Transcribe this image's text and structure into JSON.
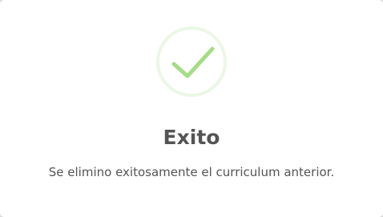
{
  "dialog": {
    "icon": "success-check-icon",
    "title": "Exito",
    "message": "Se elimino exitosamente el curriculum anterior."
  },
  "colors": {
    "success": "#a5dc86",
    "text": "#545454",
    "background": "#ffffff",
    "overlay": "#d9d9d9"
  }
}
